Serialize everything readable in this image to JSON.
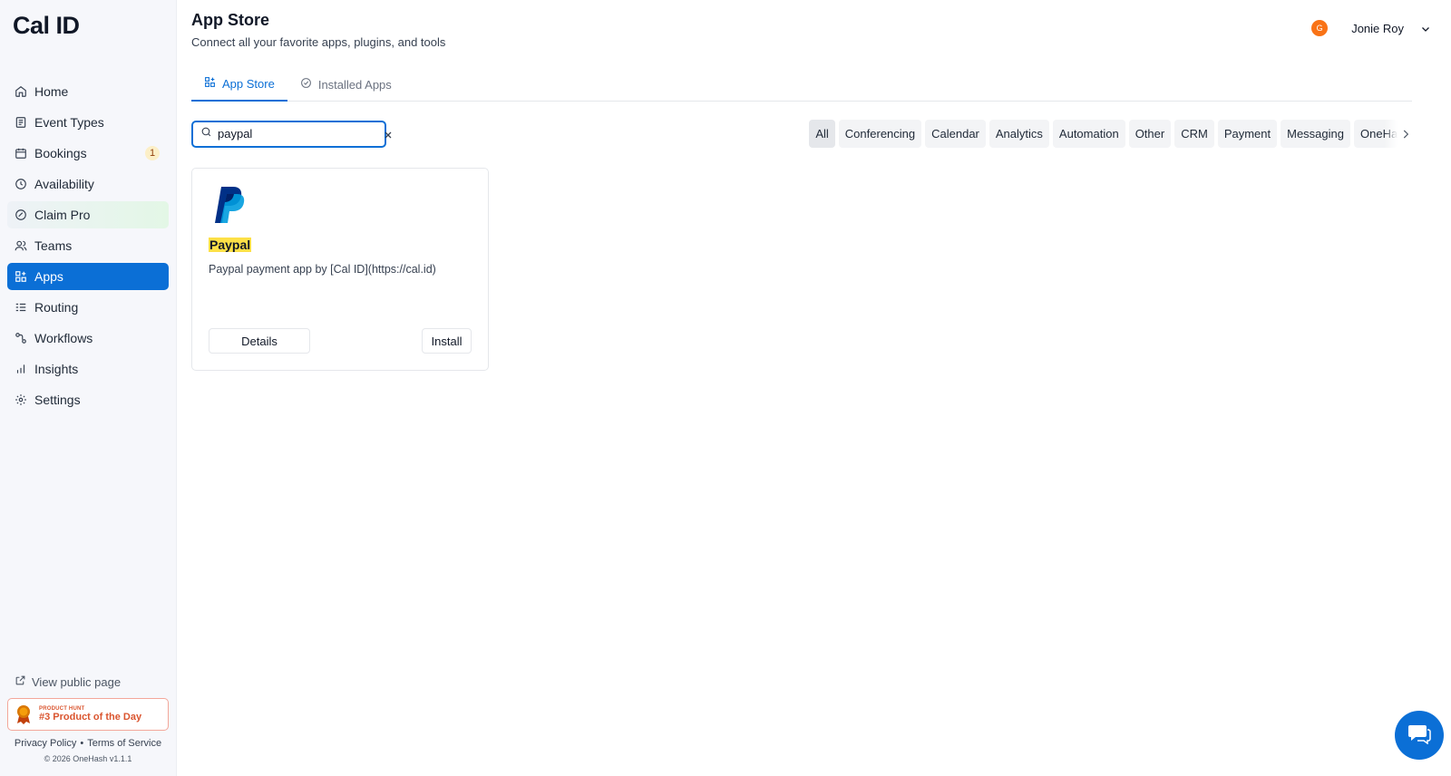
{
  "brand": {
    "logo_text": "Cal ID"
  },
  "sidebar": {
    "items": [
      {
        "label": "Home",
        "icon": "home-icon"
      },
      {
        "label": "Event Types",
        "icon": "event-types-icon"
      },
      {
        "label": "Bookings",
        "icon": "calendar-icon",
        "badge": "1"
      },
      {
        "label": "Availability",
        "icon": "clock-icon"
      },
      {
        "label": "Claim Pro",
        "icon": "badge-check-icon"
      },
      {
        "label": "Teams",
        "icon": "users-icon"
      },
      {
        "label": "Apps",
        "icon": "grid-plus-icon",
        "active": true
      },
      {
        "label": "Routing",
        "icon": "list-icon"
      },
      {
        "label": "Workflows",
        "icon": "workflow-icon"
      },
      {
        "label": "Insights",
        "icon": "bar-chart-icon"
      },
      {
        "label": "Settings",
        "icon": "gear-icon"
      }
    ],
    "view_public": "View public page",
    "product_hunt": {
      "top": "PRODUCT HUNT",
      "main": "#3 Product of the Day"
    },
    "legal": {
      "privacy": "Privacy Policy",
      "sep": "•",
      "terms": "Terms of Service"
    },
    "copyright": "© 2026 OneHash v1.1.1"
  },
  "header": {
    "title": "App Store",
    "subtitle": "Connect all your favorite apps, plugins, and tools",
    "user": {
      "initial": "G",
      "name": "Jonie Roy"
    }
  },
  "tabs": [
    {
      "label": "App Store",
      "active": true
    },
    {
      "label": "Installed Apps",
      "active": false
    }
  ],
  "search": {
    "value": "paypal",
    "placeholder": "Search"
  },
  "categories": [
    "All",
    "Conferencing",
    "Calendar",
    "Analytics",
    "Automation",
    "Other",
    "CRM",
    "Payment",
    "Messaging",
    "OneHash"
  ],
  "apps": [
    {
      "name": "Paypal",
      "description": "Paypal payment app by [Cal ID](https://cal.id)",
      "details_label": "Details",
      "install_label": "Install"
    }
  ],
  "colors": {
    "accent": "#0b6fd6",
    "highlight": "#fde047",
    "avatar": "#f97316"
  }
}
